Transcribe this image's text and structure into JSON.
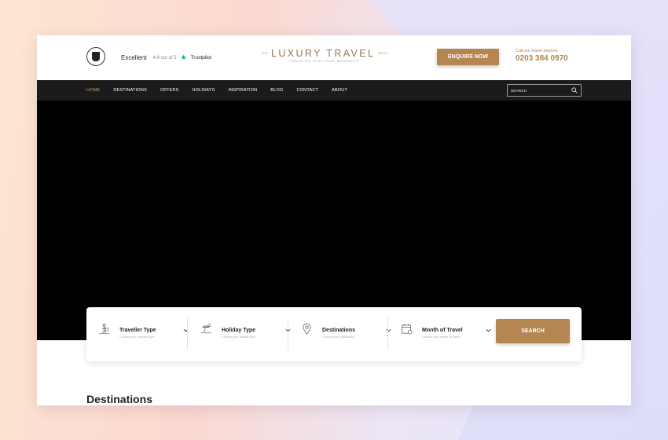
{
  "header": {
    "trustpilot": {
      "excellent": "Excellent",
      "score": "4.9 out of 5",
      "brand": "Trustpilot"
    },
    "brand": {
      "prefix": "THE",
      "name": "LUXURY TRAVEL",
      "suffix": "BOOK",
      "tagline": "CREATING LIFE-LONG MEMORIES"
    },
    "enquire_label": "ENQUIRE NOW",
    "call_label": "Call our travel experts",
    "phone": "0203 384 0970"
  },
  "nav": {
    "items": [
      {
        "label": "HOME",
        "active": true
      },
      {
        "label": "DESTINATIONS",
        "active": false
      },
      {
        "label": "OFFERS",
        "active": false
      },
      {
        "label": "HOLIDAYS",
        "active": false
      },
      {
        "label": "INSPIRATION",
        "active": false
      },
      {
        "label": "BLOG",
        "active": false
      },
      {
        "label": "CONTACT",
        "active": false
      },
      {
        "label": "ABOUT",
        "active": false
      }
    ],
    "search_placeholder": "SEARCH"
  },
  "booking": {
    "fields": [
      {
        "title": "Traveller Type",
        "hint": "Choose your traveller type",
        "icon": "traveller-icon"
      },
      {
        "title": "Holiday Type",
        "hint": "Choose your holiday type",
        "icon": "beach-icon"
      },
      {
        "title": "Destinations",
        "hint": "Choose your destination",
        "icon": "location-pin-icon"
      },
      {
        "title": "Month of Travel",
        "hint": "Choose your month of travel",
        "icon": "calendar-icon"
      }
    ],
    "search_label": "SEARCH"
  },
  "section": {
    "destinations_heading": "Destinations"
  },
  "colors": {
    "accent": "#b58552",
    "nav_bg": "#1b1b1b",
    "nav_active": "#c89a63",
    "trustpilot_green": "#00b67a"
  }
}
